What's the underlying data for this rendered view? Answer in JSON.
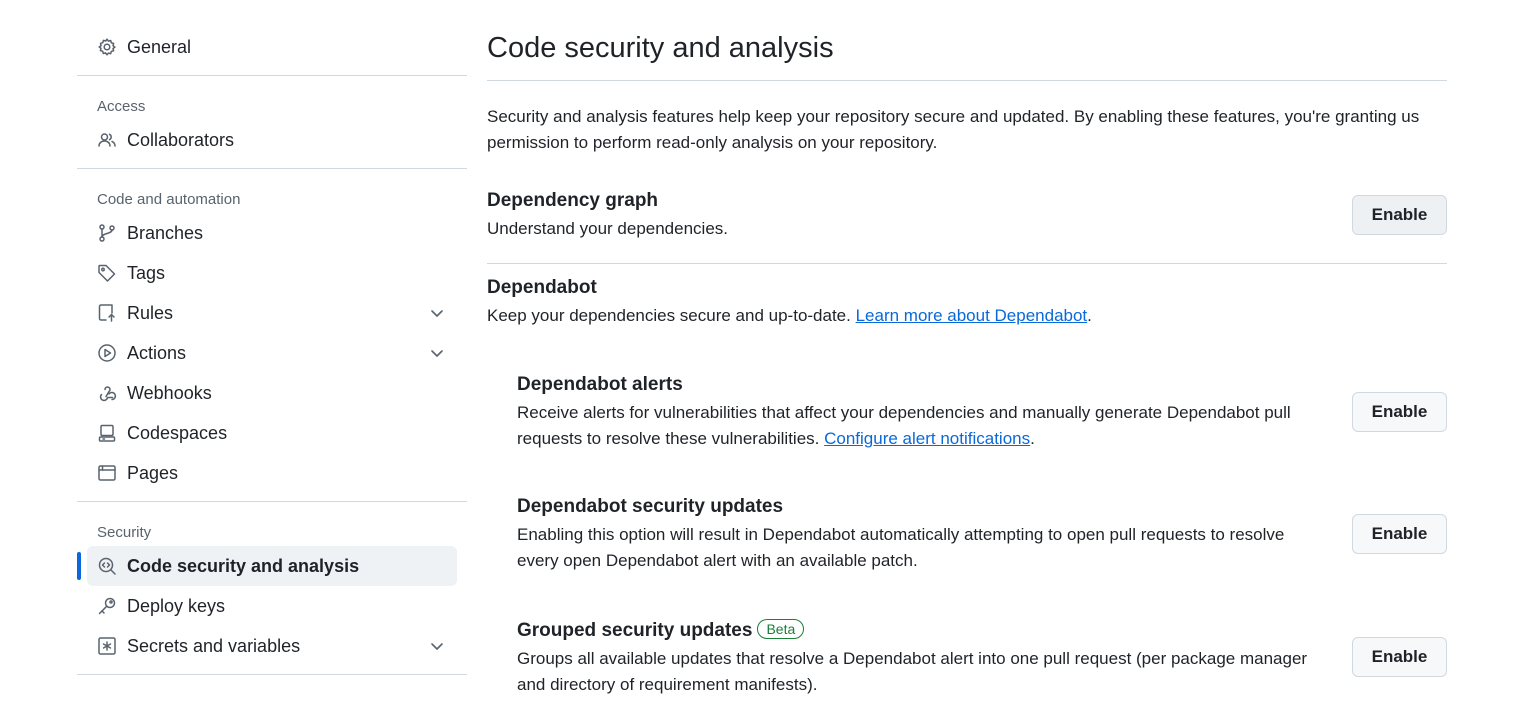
{
  "sidebar": {
    "general": "General",
    "access_heading": "Access",
    "collaborators": "Collaborators",
    "code_heading": "Code and automation",
    "branches": "Branches",
    "tags": "Tags",
    "rules": "Rules",
    "actions": "Actions",
    "webhooks": "Webhooks",
    "codespaces": "Codespaces",
    "pages": "Pages",
    "security_heading": "Security",
    "code_security": "Code security and analysis",
    "deploy_keys": "Deploy keys",
    "secrets": "Secrets and variables"
  },
  "main": {
    "title": "Code security and analysis",
    "intro": "Security and analysis features help keep your repository secure and updated. By enabling these features, you're granting us permission to perform read-only analysis on your repository.",
    "dependency_graph": {
      "title": "Dependency graph",
      "desc": "Understand your dependencies.",
      "button": "Enable"
    },
    "dependabot": {
      "title": "Dependabot",
      "desc": "Keep your dependencies secure and up-to-date. ",
      "link": "Learn more about Dependabot",
      "suffix": "."
    },
    "alerts": {
      "title": "Dependabot alerts",
      "desc": "Receive alerts for vulnerabilities that affect your dependencies and manually generate Dependabot pull requests to resolve these vulnerabilities. ",
      "link": "Configure alert notifications",
      "suffix": ".",
      "button": "Enable"
    },
    "security_updates": {
      "title": "Dependabot security updates",
      "desc": "Enabling this option will result in Dependabot automatically attempting to open pull requests to resolve every open Dependabot alert with an available patch.",
      "button": "Enable"
    },
    "grouped": {
      "title": "Grouped security updates",
      "badge": "Beta",
      "desc": "Groups all available updates that resolve a Dependabot alert into one pull request (per package manager and directory of requirement manifests).",
      "button": "Enable"
    }
  },
  "colors": {
    "accent": "#0969da",
    "badge_green": "#1a7f37",
    "border": "#d1d9e0"
  },
  "icons": {
    "general": "gear-icon",
    "collaborators": "people-icon",
    "branches": "git-branch-icon",
    "tags": "tag-icon",
    "rules": "repo-push-icon",
    "actions": "play-icon",
    "webhooks": "webhook-icon",
    "codespaces": "codespaces-icon",
    "pages": "browser-icon",
    "code_security": "codescan-icon",
    "deploy_keys": "key-icon",
    "secrets": "key-asterisk-icon"
  }
}
